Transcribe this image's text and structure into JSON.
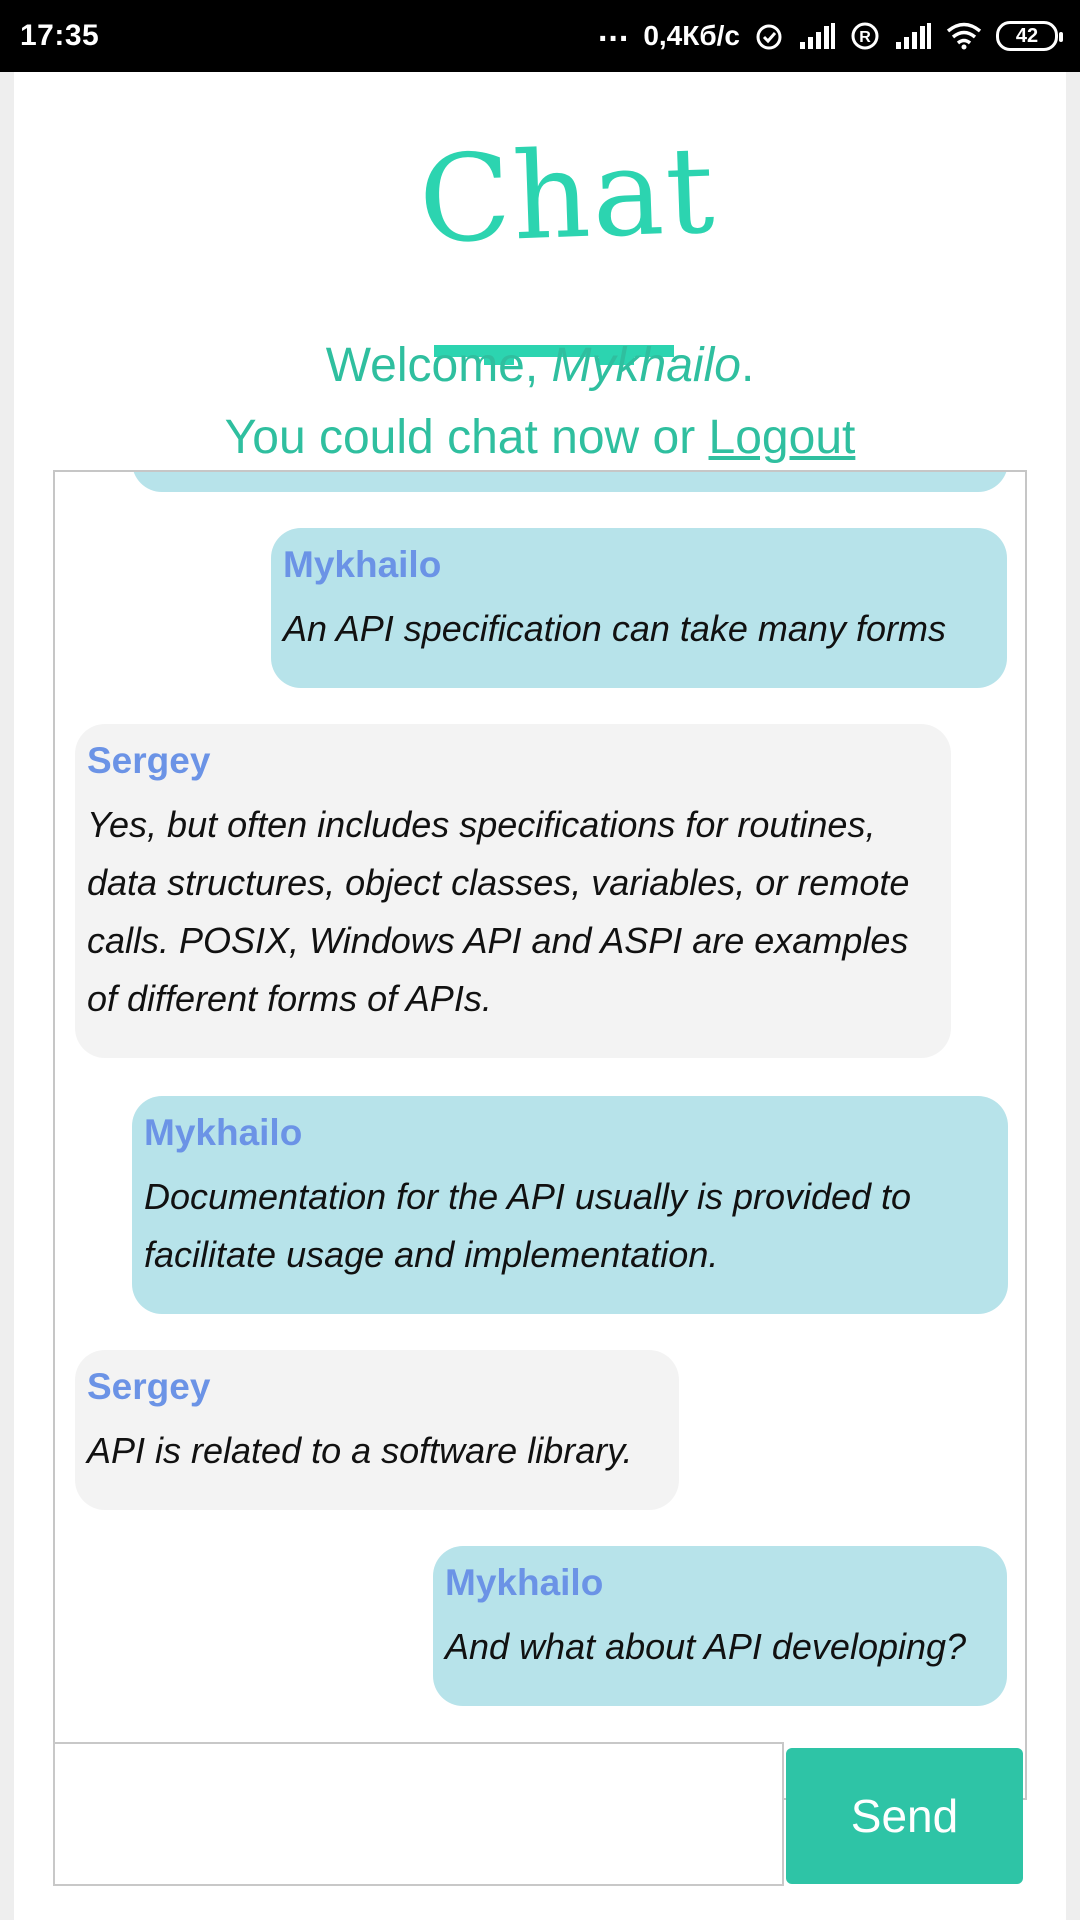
{
  "status_bar": {
    "time": "17:35",
    "dots": "...",
    "network_speed": "0,4Кб/с",
    "battery_level": "42",
    "icons": [
      "alarm-icon",
      "signal-icon",
      "registered-icon",
      "signal-icon",
      "wifi-icon",
      "battery-icon"
    ]
  },
  "header": {
    "logo_text": "Chat",
    "welcome_prefix": "Welcome, ",
    "username": "Mykhailo",
    "welcome_suffix": ".",
    "chat_prefix": "You could chat now or ",
    "logout_label": "Logout"
  },
  "messages": [
    {
      "author": "Mykhailo",
      "text": "An API specification can take many forms",
      "mine": true
    },
    {
      "author": "Sergey",
      "text": "Yes, but often includes specifications for routines, data structures, object classes, variables, or remote calls. POSIX, Windows API and ASPI are examples of different forms of APIs.",
      "mine": false
    },
    {
      "author": "Mykhailo",
      "text": "Documentation for the API usually is provided to facilitate usage and implementation.",
      "mine": true
    },
    {
      "author": "Sergey",
      "text": "API is related to a software library.",
      "mine": false
    },
    {
      "author": "Mykhailo",
      "text": "And what about API developing?",
      "mine": true
    }
  ],
  "composer": {
    "input_value": "",
    "send_label": "Send"
  },
  "colors": {
    "accent": "#2ec4a6",
    "own_bubble": "#b7e3ea",
    "other_bubble": "#f3f3f3",
    "author_name": "#6b93e6"
  }
}
